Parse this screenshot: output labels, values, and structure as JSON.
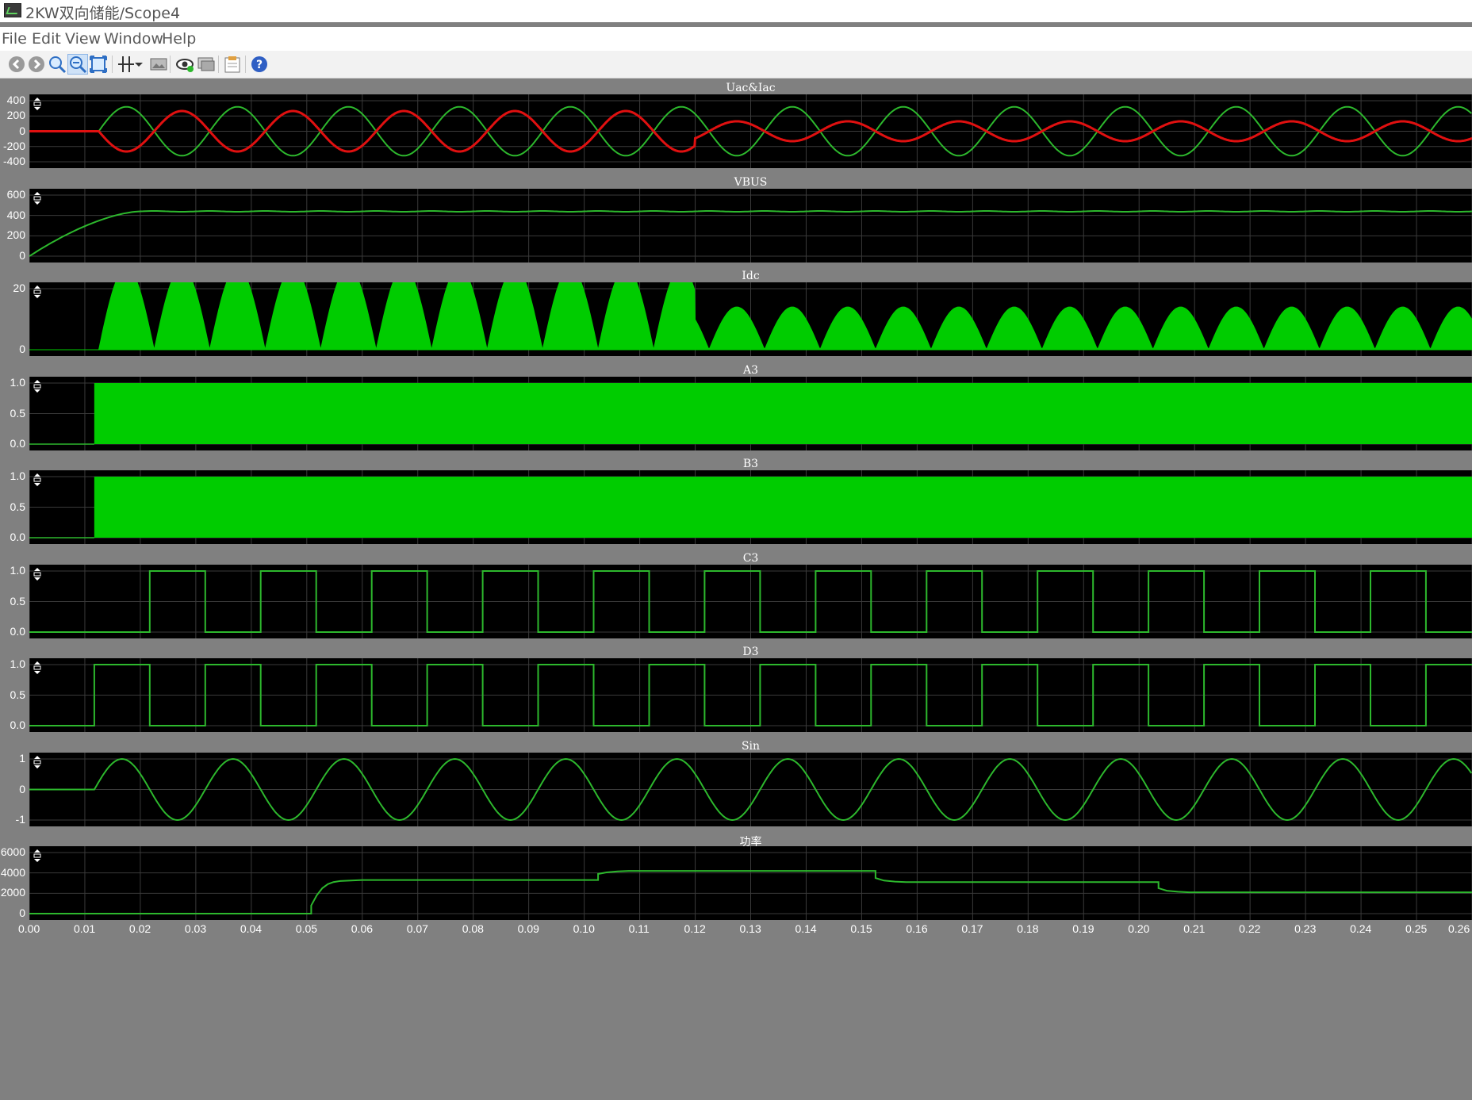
{
  "window": {
    "title": "2KW双向储能/Scope4"
  },
  "menu": [
    "File",
    "Edit",
    "View",
    "Window",
    "Help"
  ],
  "toolbar": [
    {
      "name": "back-icon",
      "active": false
    },
    {
      "name": "forward-icon",
      "active": false
    },
    {
      "name": "zoom-icon",
      "active": false
    },
    {
      "name": "zoom-x-icon",
      "active": true
    },
    {
      "name": "fit-view-icon",
      "active": false
    },
    {
      "name": "cursor-icon",
      "active": false
    },
    {
      "name": "dropdown-icon",
      "active": false
    },
    {
      "name": "image-icon",
      "active": false
    },
    {
      "name": "view-signals-icon",
      "active": false
    },
    {
      "name": "display-icon",
      "active": false
    },
    {
      "name": "properties-icon",
      "active": false
    },
    {
      "name": "help-icon",
      "active": false
    }
  ],
  "colors": {
    "background": "#808080",
    "plot": "#000000",
    "green": "#2db82d",
    "fill": "#00cc00",
    "red": "#e01010",
    "grid": "#3a3a3a"
  },
  "x_axis": {
    "ticks": [
      "0.00",
      "0.01",
      "0.02",
      "0.03",
      "0.04",
      "0.05",
      "0.06",
      "0.07",
      "0.08",
      "0.09",
      "0.10",
      "0.11",
      "0.12",
      "0.13",
      "0.14",
      "0.15",
      "0.16",
      "0.17",
      "0.18",
      "0.19",
      "0.20",
      "0.21",
      "0.22",
      "0.23",
      "0.24",
      "0.25",
      "0.26"
    ],
    "range": [
      0,
      0.26
    ]
  },
  "chart_data": [
    {
      "type": "line",
      "title": "Uac&Iac",
      "yticks": [
        "400",
        "200",
        "0",
        "-200",
        "-400"
      ],
      "ylim": [
        -400,
        400
      ],
      "series": [
        {
          "kind": "sine",
          "color": "green",
          "amp": 320,
          "freq": 50,
          "start": 0.0125,
          "phase": "sin"
        },
        {
          "kind": "sine",
          "color": "red",
          "segments": [
            {
              "from": 0.0125,
              "to": 0.12,
              "amp": -265
            },
            {
              "from": 0.12,
              "to": 0.26,
              "amp": -130
            }
          ]
        }
      ]
    },
    {
      "type": "line",
      "title": "VBUS",
      "yticks": [
        "600",
        "400",
        "200",
        "0"
      ],
      "ylim": [
        0,
        600
      ],
      "series": [
        {
          "kind": "rise",
          "color": "green",
          "start": 0.0,
          "settle": 0.02,
          "final": 440
        }
      ]
    },
    {
      "type": "area",
      "title": "Idc",
      "yticks": [
        "20",
        "0"
      ],
      "ylim": [
        -5,
        30
      ],
      "series": [
        {
          "kind": "rectified",
          "color": "fill",
          "start": 0.0125,
          "segments": [
            {
              "from": 0.0125,
              "to": 0.12,
              "amp": 27
            },
            {
              "from": 0.12,
              "to": 0.26,
              "amp": 14
            }
          ]
        }
      ]
    },
    {
      "type": "area",
      "title": "A3",
      "yticks": [
        "1.0",
        "0.5",
        "0.0"
      ],
      "ylim": [
        -0.1,
        1.1
      ],
      "series": [
        {
          "kind": "pwm-block",
          "color": "fill",
          "start": 0.0117
        }
      ]
    },
    {
      "type": "area",
      "title": "B3",
      "yticks": [
        "1.0",
        "0.5",
        "0.0"
      ],
      "ylim": [
        -0.1,
        1.1
      ],
      "series": [
        {
          "kind": "pwm-block",
          "color": "fill",
          "start": 0.0117
        }
      ]
    },
    {
      "type": "line",
      "title": "C3",
      "yticks": [
        "1.0",
        "0.5",
        "0.0"
      ],
      "ylim": [
        -0.1,
        1.1
      ],
      "series": [
        {
          "kind": "square",
          "color": "green",
          "first_high": 0.0217,
          "half_period": 0.01
        }
      ]
    },
    {
      "type": "line",
      "title": "D3",
      "yticks": [
        "1.0",
        "0.5",
        "0.0"
      ],
      "ylim": [
        -0.1,
        1.1
      ],
      "series": [
        {
          "kind": "square",
          "color": "green",
          "first_high": 0.0117,
          "half_period": 0.01
        }
      ]
    },
    {
      "type": "line",
      "title": "Sin",
      "yticks": [
        "1",
        "0",
        "-1"
      ],
      "ylim": [
        -1.1,
        1.1
      ],
      "series": [
        {
          "kind": "sine",
          "color": "green",
          "amp": 1,
          "freq": 50,
          "start": 0.0117,
          "phase": "sin"
        }
      ]
    },
    {
      "type": "line",
      "title": "功率",
      "yticks": [
        "6000",
        "4000",
        "2000",
        "0"
      ],
      "ylim": [
        -300,
        6300
      ],
      "series": [
        {
          "kind": "steps",
          "color": "green",
          "points": [
            [
              0,
              0
            ],
            [
              0.0508,
              0
            ],
            [
              0.0508,
              800
            ],
            [
              0.0518,
              1800
            ],
            [
              0.0528,
              2500
            ],
            [
              0.0538,
              2900
            ],
            [
              0.0548,
              3100
            ],
            [
              0.056,
              3200
            ],
            [
              0.058,
              3250
            ],
            [
              0.06,
              3300
            ],
            [
              0.1025,
              3300
            ],
            [
              0.1025,
              3900
            ],
            [
              0.104,
              4050
            ],
            [
              0.106,
              4150
            ],
            [
              0.108,
              4200
            ],
            [
              0.1525,
              4200
            ],
            [
              0.1525,
              3500
            ],
            [
              0.154,
              3250
            ],
            [
              0.156,
              3150
            ],
            [
              0.158,
              3100
            ],
            [
              0.2035,
              3100
            ],
            [
              0.2035,
              2500
            ],
            [
              0.205,
              2250
            ],
            [
              0.207,
              2150
            ],
            [
              0.209,
              2100
            ],
            [
              0.26,
              2100
            ]
          ]
        }
      ]
    }
  ]
}
